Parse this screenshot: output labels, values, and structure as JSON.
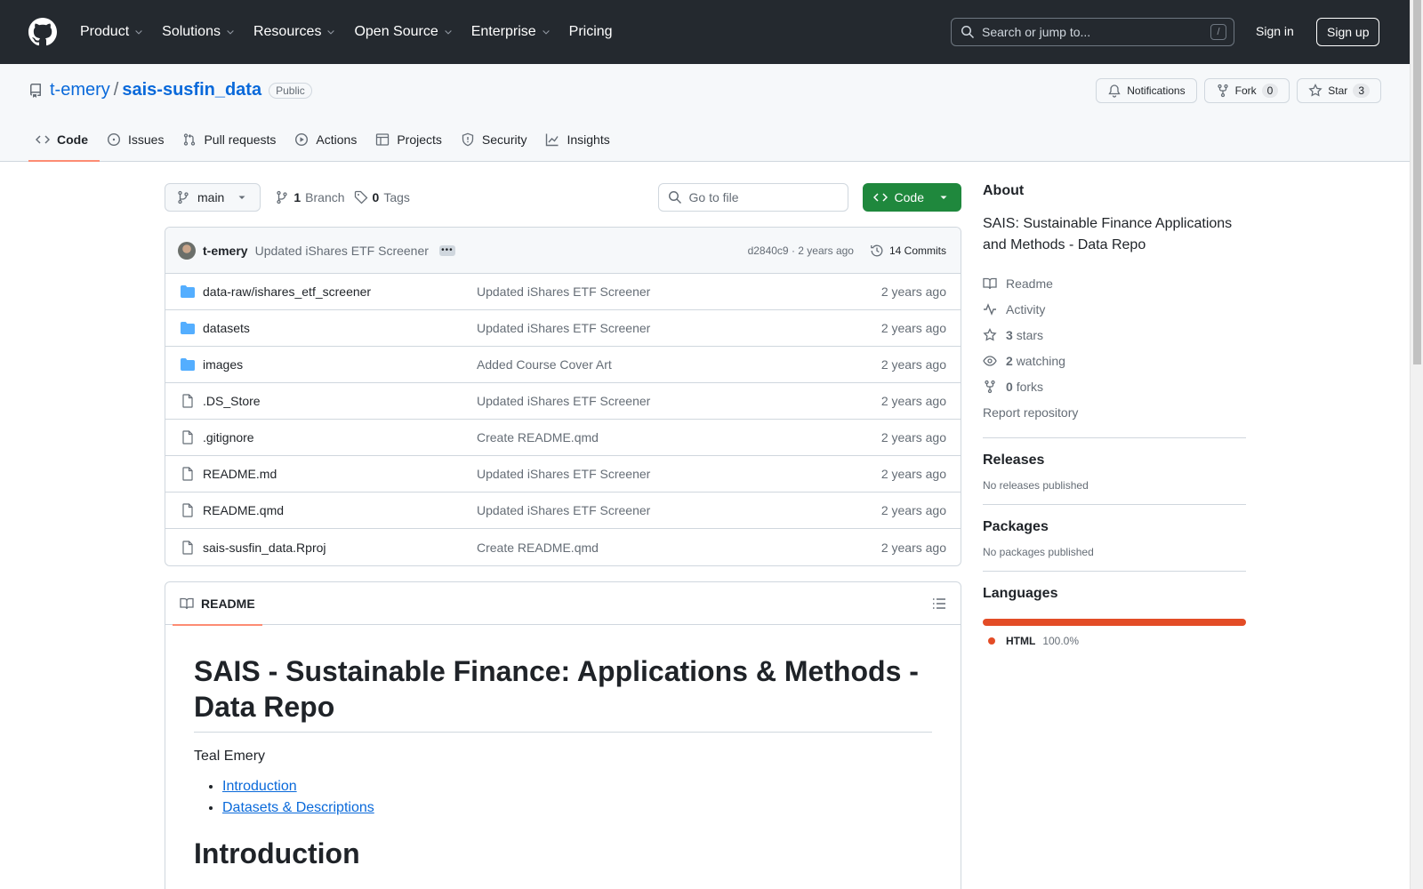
{
  "header": {
    "nav": [
      "Product",
      "Solutions",
      "Resources",
      "Open Source",
      "Enterprise",
      "Pricing"
    ],
    "search_placeholder": "Search or jump to...",
    "search_shortcut": "/",
    "signin": "Sign in",
    "signup": "Sign up"
  },
  "repo": {
    "owner": "t-emery",
    "name": "sais-susfin_data",
    "visibility": "Public",
    "notifications": "Notifications",
    "fork_label": "Fork",
    "fork_count": "0",
    "star_label": "Star",
    "star_count": "3",
    "tabs": [
      "Code",
      "Issues",
      "Pull requests",
      "Actions",
      "Projects",
      "Security",
      "Insights"
    ]
  },
  "toolbar": {
    "branch": "main",
    "branch_count": "1",
    "branch_label": "Branch",
    "tag_count": "0",
    "tag_label": "Tags",
    "goto_placeholder": "Go to file",
    "code_button": "Code"
  },
  "commit": {
    "author": "t-emery",
    "message": "Updated iShares ETF Screener",
    "hash_age": "d2840c9 · 2 years ago",
    "commits": "14 Commits"
  },
  "files": [
    {
      "name": "data-raw/ishares_etf_screener",
      "type": "dir",
      "commit": "Updated iShares ETF Screener",
      "age": "2 years ago"
    },
    {
      "name": "datasets",
      "type": "dir",
      "commit": "Updated iShares ETF Screener",
      "age": "2 years ago"
    },
    {
      "name": "images",
      "type": "dir",
      "commit": "Added Course Cover Art",
      "age": "2 years ago"
    },
    {
      "name": ".DS_Store",
      "type": "file",
      "commit": "Updated iShares ETF Screener",
      "age": "2 years ago"
    },
    {
      "name": ".gitignore",
      "type": "file",
      "commit": "Create README.qmd",
      "age": "2 years ago"
    },
    {
      "name": "README.md",
      "type": "file",
      "commit": "Updated iShares ETF Screener",
      "age": "2 years ago"
    },
    {
      "name": "README.qmd",
      "type": "file",
      "commit": "Updated iShares ETF Screener",
      "age": "2 years ago"
    },
    {
      "name": "sais-susfin_data.Rproj",
      "type": "file",
      "commit": "Create README.qmd",
      "age": "2 years ago"
    }
  ],
  "readme": {
    "tab": "README",
    "title": "SAIS - Sustainable Finance: Applications & Methods - Data Repo",
    "author": "Teal Emery",
    "toc": [
      "Introduction",
      "Datasets & Descriptions"
    ],
    "section_heading": "Introduction"
  },
  "about": {
    "heading": "About",
    "description": "SAIS: Sustainable Finance Applications and Methods - Data Repo",
    "readme": "Readme",
    "activity": "Activity",
    "stars_count": "3",
    "stars_label": "stars",
    "watching_count": "2",
    "watching_label": "watching",
    "forks_count": "0",
    "forks_label": "forks",
    "report": "Report repository"
  },
  "releases": {
    "heading": "Releases",
    "empty": "No releases published"
  },
  "packages": {
    "heading": "Packages",
    "empty": "No packages published"
  },
  "languages": {
    "heading": "Languages",
    "items": [
      {
        "name": "HTML",
        "percent": "100.0%",
        "color": "#e34c26",
        "share": 1.0
      }
    ]
  },
  "colors": {
    "header_bg": "#24292f",
    "link": "#0969da",
    "green": "#1f883d",
    "tab_underline": "#fd8c73"
  }
}
